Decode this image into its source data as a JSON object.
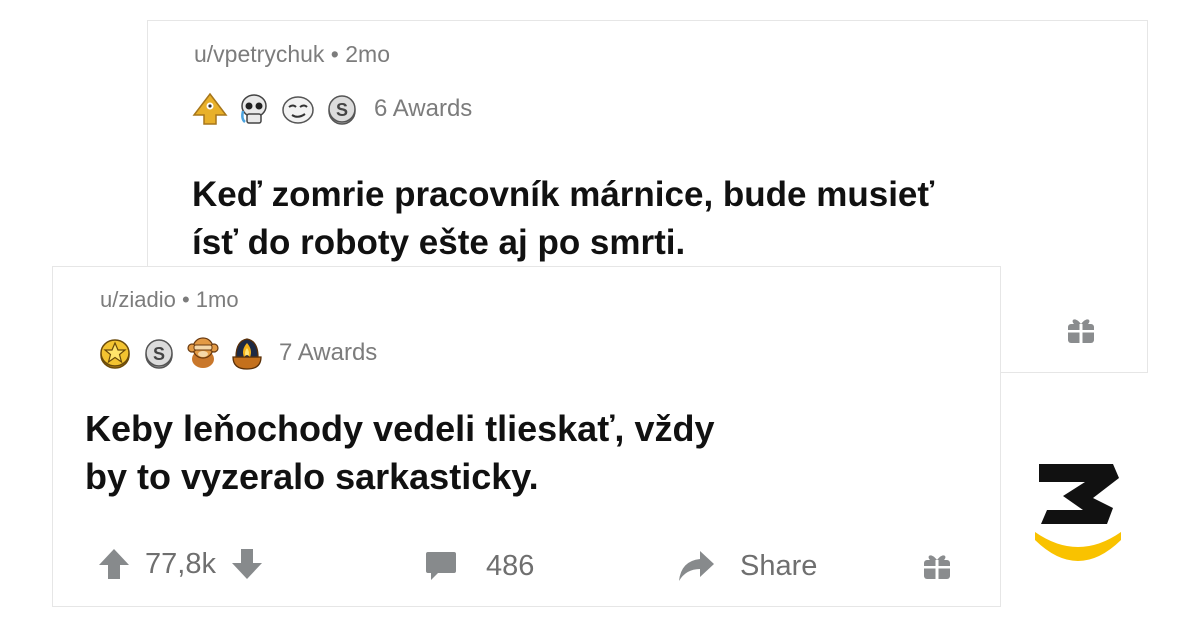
{
  "post1": {
    "username": "u/vpetrychuk",
    "separator": "•",
    "age": "2mo",
    "awards_label": "6 Awards",
    "award_icons": [
      "pyramid-award-icon",
      "skull-award-icon",
      "smug-face-award-icon",
      "silver-coin-award-icon"
    ],
    "text_line1": "Keď zomrie pracovník márnice, bude musieť",
    "text_line2": "ísť do roboty ešte aj po smrti."
  },
  "post2": {
    "username": "u/ziadio",
    "separator": "•",
    "age": "1mo",
    "awards_label": "7 Awards",
    "award_icons": [
      "gold-star-award-icon",
      "silver-coin-award-icon",
      "monkey-award-icon",
      "fire-bowl-award-icon"
    ],
    "text_line1": "Keby leňochody vedeli tlieskať, vždy",
    "text_line2": "by to vyzeralo sarkasticky.",
    "actions": {
      "vote_count": "77,8k",
      "comment_count": "486",
      "share_label": "Share"
    }
  },
  "colors": {
    "meta_gray": "#7c7c7c",
    "icon_gray": "#878a8c",
    "logo_black": "#111111",
    "logo_yellow": "#f9c200"
  }
}
